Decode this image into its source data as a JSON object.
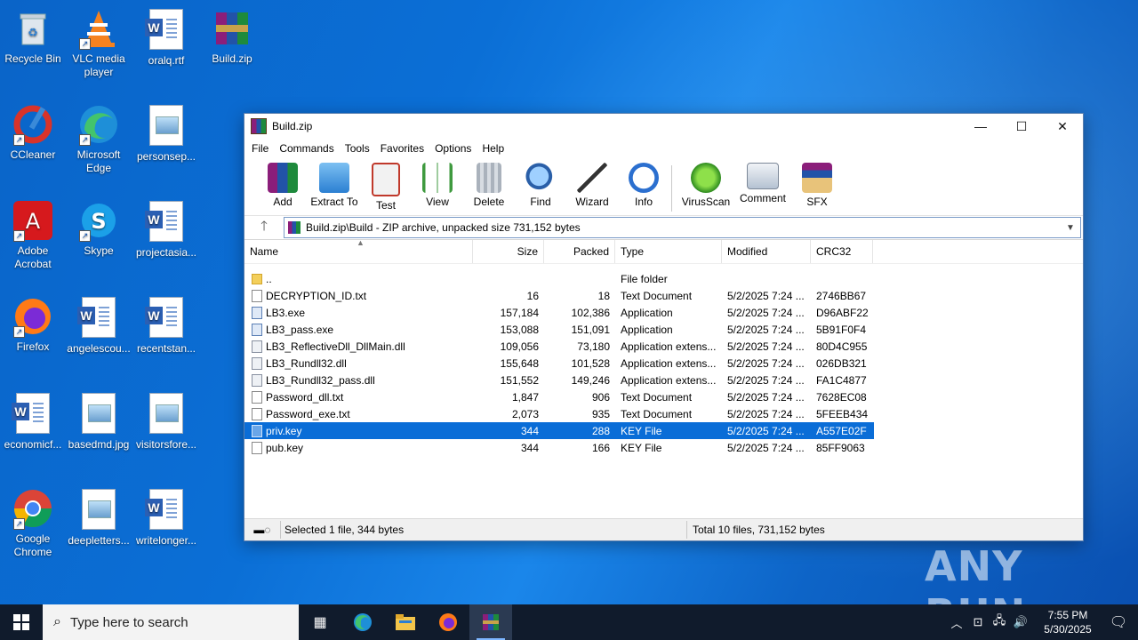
{
  "desktop": {
    "icons": [
      {
        "label": "Recycle Bin"
      },
      {
        "label": "VLC media player"
      },
      {
        "label": "oralq.rtf"
      },
      {
        "label": "Build.zip"
      },
      {
        "label": "CCleaner"
      },
      {
        "label": "Microsoft Edge"
      },
      {
        "label": "personsep..."
      },
      {
        "label": "Adobe Acrobat"
      },
      {
        "label": "Skype"
      },
      {
        "label": "projectasia..."
      },
      {
        "label": "Firefox"
      },
      {
        "label": "angelescou..."
      },
      {
        "label": "recentstan..."
      },
      {
        "label": "economicf..."
      },
      {
        "label": "basedmd.jpg"
      },
      {
        "label": "visitorsfore..."
      },
      {
        "label": "Google Chrome"
      },
      {
        "label": "deepletters..."
      },
      {
        "label": "writelonger..."
      }
    ]
  },
  "window": {
    "title": "Build.zip",
    "menu": [
      "File",
      "Commands",
      "Tools",
      "Favorites",
      "Options",
      "Help"
    ],
    "toolbar": [
      "Add",
      "Extract To",
      "Test",
      "View",
      "Delete",
      "Find",
      "Wizard",
      "Info",
      "VirusScan",
      "Comment",
      "SFX"
    ],
    "address": "Build.zip\\Build - ZIP archive, unpacked size 731,152 bytes",
    "columns": [
      "Name",
      "Size",
      "Packed",
      "Type",
      "Modified",
      "CRC32"
    ],
    "files": [
      {
        "name": "..",
        "size": "",
        "packed": "",
        "type": "File folder",
        "modified": "",
        "crc": ""
      },
      {
        "name": "DECRYPTION_ID.txt",
        "size": "16",
        "packed": "18",
        "type": "Text Document",
        "modified": "5/2/2025 7:24 ...",
        "crc": "2746BB67"
      },
      {
        "name": "LB3.exe",
        "size": "157,184",
        "packed": "102,386",
        "type": "Application",
        "modified": "5/2/2025 7:24 ...",
        "crc": "D96ABF22"
      },
      {
        "name": "LB3_pass.exe",
        "size": "153,088",
        "packed": "151,091",
        "type": "Application",
        "modified": "5/2/2025 7:24 ...",
        "crc": "5B91F0F4"
      },
      {
        "name": "LB3_ReflectiveDll_DllMain.dll",
        "size": "109,056",
        "packed": "73,180",
        "type": "Application extens...",
        "modified": "5/2/2025 7:24 ...",
        "crc": "80D4C955"
      },
      {
        "name": "LB3_Rundll32.dll",
        "size": "155,648",
        "packed": "101,528",
        "type": "Application extens...",
        "modified": "5/2/2025 7:24 ...",
        "crc": "026DB321"
      },
      {
        "name": "LB3_Rundll32_pass.dll",
        "size": "151,552",
        "packed": "149,246",
        "type": "Application extens...",
        "modified": "5/2/2025 7:24 ...",
        "crc": "FA1C4877"
      },
      {
        "name": "Password_dll.txt",
        "size": "1,847",
        "packed": "906",
        "type": "Text Document",
        "modified": "5/2/2025 7:24 ...",
        "crc": "7628EC08"
      },
      {
        "name": "Password_exe.txt",
        "size": "2,073",
        "packed": "935",
        "type": "Text Document",
        "modified": "5/2/2025 7:24 ...",
        "crc": "5FEEB434"
      },
      {
        "name": "priv.key",
        "size": "344",
        "packed": "288",
        "type": "KEY File",
        "modified": "5/2/2025 7:24 ...",
        "crc": "A557E02F"
      },
      {
        "name": "pub.key",
        "size": "344",
        "packed": "166",
        "type": "KEY File",
        "modified": "5/2/2025 7:24 ...",
        "crc": "85FF9063"
      }
    ],
    "status_left": "Selected 1 file, 344 bytes",
    "status_right": "Total 10 files, 731,152 bytes"
  },
  "taskbar": {
    "search_placeholder": "Type here to search",
    "time": "7:55 PM",
    "date": "5/30/2025"
  },
  "watermark": "ANY RUN"
}
